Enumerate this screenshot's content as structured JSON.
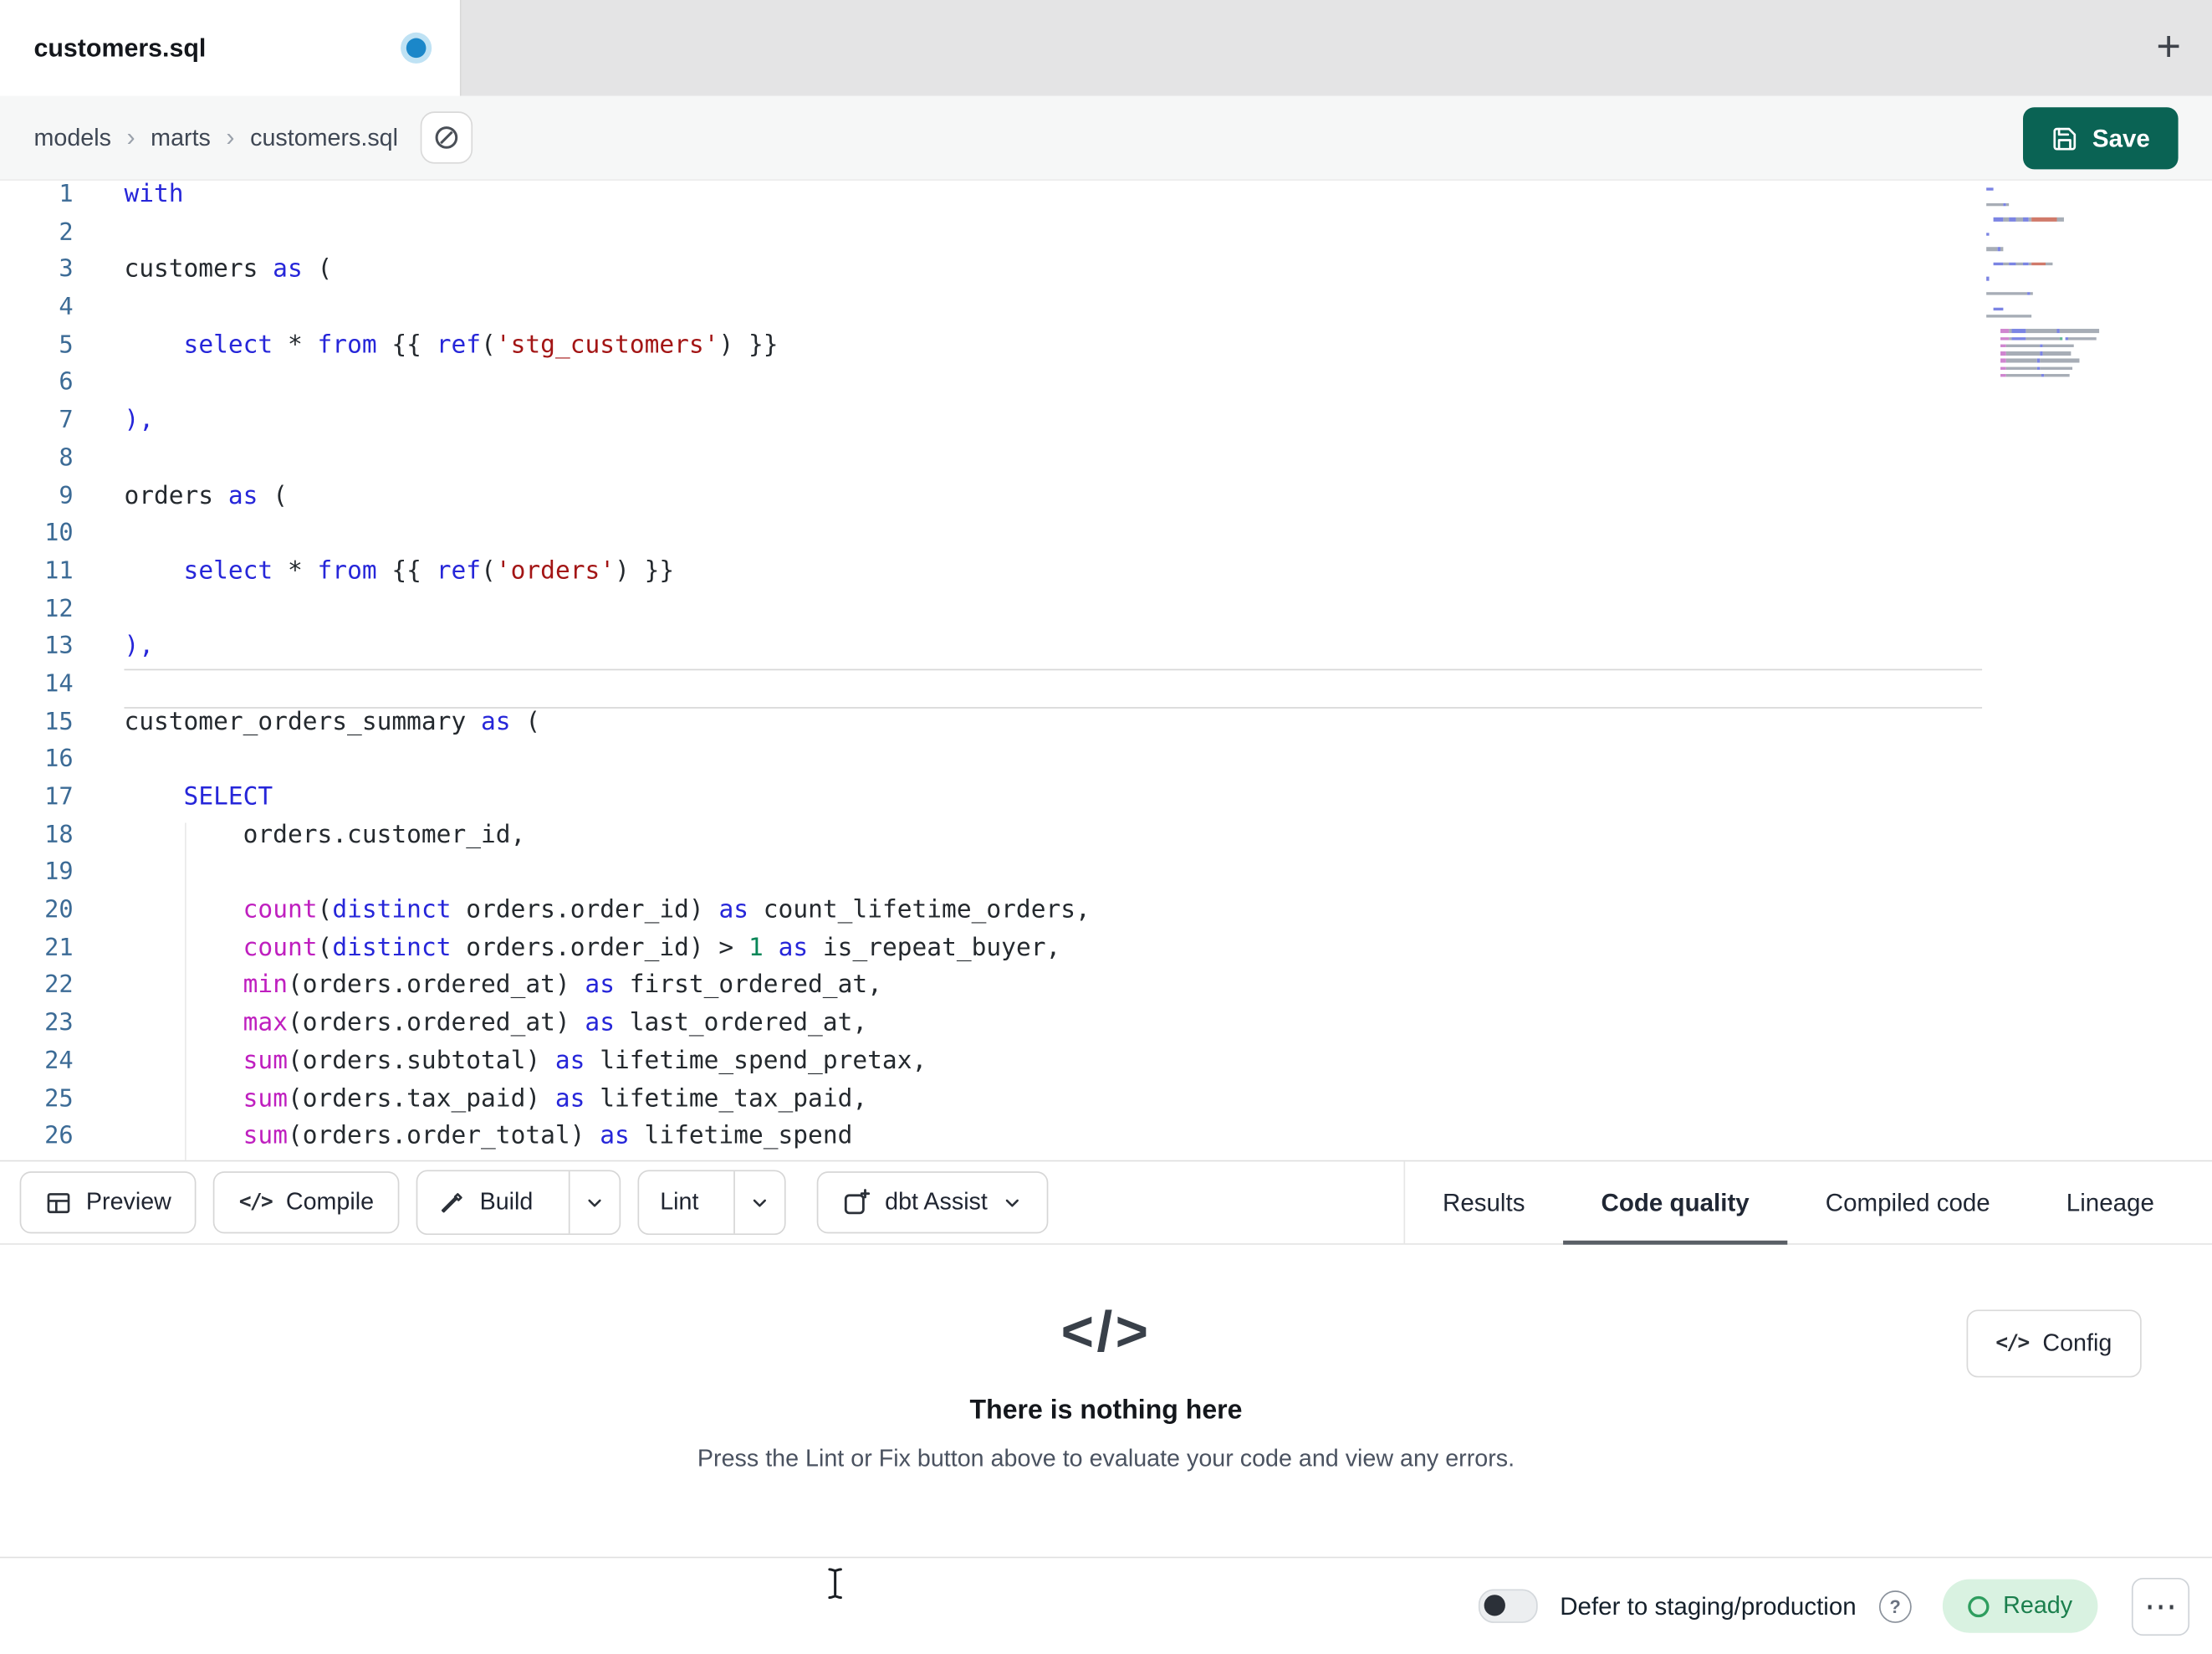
{
  "tab_bar": {
    "active_tab": "customers.sql",
    "new_tab": "+"
  },
  "breadcrumb": {
    "items": [
      "models",
      "marts",
      "customers.sql"
    ],
    "separator": "›"
  },
  "actions": {
    "save": "Save"
  },
  "editor": {
    "current_line": 14,
    "lines": [
      {
        "n": 1,
        "tokens": [
          [
            "kw",
            "with"
          ]
        ]
      },
      {
        "n": 2,
        "tokens": []
      },
      {
        "n": 3,
        "tokens": [
          [
            "pl",
            "customers "
          ],
          [
            "kw",
            "as"
          ],
          [
            "pl",
            " ("
          ]
        ]
      },
      {
        "n": 4,
        "tokens": []
      },
      {
        "n": 5,
        "tokens": [
          [
            "pl",
            "    "
          ],
          [
            "kw",
            "select"
          ],
          [
            "pl",
            " * "
          ],
          [
            "kw",
            "from"
          ],
          [
            "pl",
            " {{ "
          ],
          [
            "kw",
            "ref"
          ],
          [
            "pl",
            "("
          ],
          [
            "str",
            "'stg_customers'"
          ],
          [
            "pl",
            ") }}"
          ]
        ]
      },
      {
        "n": 6,
        "tokens": []
      },
      {
        "n": 7,
        "tokens": [
          [
            "kw",
            "),"
          ]
        ]
      },
      {
        "n": 8,
        "tokens": []
      },
      {
        "n": 9,
        "tokens": [
          [
            "pl",
            "orders "
          ],
          [
            "kw",
            "as"
          ],
          [
            "pl",
            " ("
          ]
        ]
      },
      {
        "n": 10,
        "tokens": []
      },
      {
        "n": 11,
        "tokens": [
          [
            "pl",
            "    "
          ],
          [
            "kw",
            "select"
          ],
          [
            "pl",
            " * "
          ],
          [
            "kw",
            "from"
          ],
          [
            "pl",
            " {{ "
          ],
          [
            "kw",
            "ref"
          ],
          [
            "pl",
            "("
          ],
          [
            "str",
            "'orders'"
          ],
          [
            "pl",
            ") }}"
          ]
        ]
      },
      {
        "n": 12,
        "tokens": []
      },
      {
        "n": 13,
        "tokens": [
          [
            "kw",
            "),"
          ]
        ]
      },
      {
        "n": 14,
        "tokens": []
      },
      {
        "n": 15,
        "tokens": [
          [
            "pl",
            "customer_orders_summary "
          ],
          [
            "kw",
            "as"
          ],
          [
            "pl",
            " ("
          ]
        ]
      },
      {
        "n": 16,
        "tokens": []
      },
      {
        "n": 17,
        "tokens": [
          [
            "pl",
            "    "
          ],
          [
            "kw",
            "SELECT"
          ]
        ]
      },
      {
        "n": 18,
        "tokens": [
          [
            "pl",
            "        orders.customer_id,"
          ]
        ]
      },
      {
        "n": 19,
        "tokens": []
      },
      {
        "n": 20,
        "tokens": [
          [
            "pl",
            "        "
          ],
          [
            "fn",
            "count"
          ],
          [
            "pl",
            "("
          ],
          [
            "kw",
            "distinct"
          ],
          [
            "pl",
            " orders.order_id) "
          ],
          [
            "kw",
            "as"
          ],
          [
            "pl",
            " count_lifetime_orders,"
          ]
        ]
      },
      {
        "n": 21,
        "tokens": [
          [
            "pl",
            "        "
          ],
          [
            "fn",
            "count"
          ],
          [
            "pl",
            "("
          ],
          [
            "kw",
            "distinct"
          ],
          [
            "pl",
            " orders.order_id) > "
          ],
          [
            "num",
            "1"
          ],
          [
            "pl",
            " "
          ],
          [
            "kw",
            "as"
          ],
          [
            "pl",
            " is_repeat_buyer,"
          ]
        ]
      },
      {
        "n": 22,
        "tokens": [
          [
            "pl",
            "        "
          ],
          [
            "fn",
            "min"
          ],
          [
            "pl",
            "(orders.ordered_at) "
          ],
          [
            "kw",
            "as"
          ],
          [
            "pl",
            " first_ordered_at,"
          ]
        ]
      },
      {
        "n": 23,
        "tokens": [
          [
            "pl",
            "        "
          ],
          [
            "fn",
            "max"
          ],
          [
            "pl",
            "(orders.ordered_at) "
          ],
          [
            "kw",
            "as"
          ],
          [
            "pl",
            " last_ordered_at,"
          ]
        ]
      },
      {
        "n": 24,
        "tokens": [
          [
            "pl",
            "        "
          ],
          [
            "fn",
            "sum"
          ],
          [
            "pl",
            "(orders.subtotal) "
          ],
          [
            "kw",
            "as"
          ],
          [
            "pl",
            " lifetime_spend_pretax,"
          ]
        ]
      },
      {
        "n": 25,
        "tokens": [
          [
            "pl",
            "        "
          ],
          [
            "fn",
            "sum"
          ],
          [
            "pl",
            "(orders.tax_paid) "
          ],
          [
            "kw",
            "as"
          ],
          [
            "pl",
            " lifetime_tax_paid,"
          ]
        ]
      },
      {
        "n": 26,
        "tokens": [
          [
            "pl",
            "        "
          ],
          [
            "fn",
            "sum"
          ],
          [
            "pl",
            "(orders.order_total) "
          ],
          [
            "kw",
            "as"
          ],
          [
            "pl",
            " lifetime_spend"
          ]
        ]
      }
    ]
  },
  "toolbar": {
    "preview": "Preview",
    "compile": "Compile",
    "build": "Build",
    "lint": "Lint",
    "assist": "dbt Assist",
    "code_glyph": "</>"
  },
  "panel_tabs": [
    {
      "label": "Results",
      "active": false
    },
    {
      "label": "Code quality",
      "active": true
    },
    {
      "label": "Compiled code",
      "active": false
    },
    {
      "label": "Lineage",
      "active": false
    }
  ],
  "empty_state": {
    "glyph": "</>",
    "title": "There is nothing here",
    "subtitle": "Press the Lint or Fix button above to evaluate your code and view any errors.",
    "config": "Config"
  },
  "status_bar": {
    "defer": "Defer to staging/production",
    "help": "?",
    "ready": "Ready",
    "more": "⋯"
  },
  "colors": {
    "save_button": "#0a6354",
    "keyword": "#2626d9",
    "string": "#a31515",
    "function": "#bf1fbf",
    "number": "#098658",
    "line_number": "#3c6b96",
    "ready_green": "#1b7f4d",
    "dirty_dot_blue": "#1b87c9"
  }
}
